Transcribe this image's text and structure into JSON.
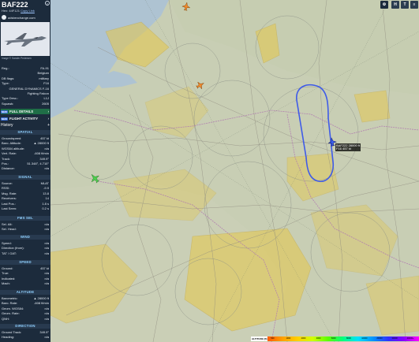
{
  "aircraft": {
    "callsign": "BAF222",
    "hex_label": "Hex:",
    "hex": "44F121",
    "copy_link": "Copy Link",
    "source": "adsbexchange.com",
    "photo_credit": "Image © Sander Pedersen"
  },
  "details": [
    {
      "k": "Reg.:",
      "v": "FA-91"
    },
    {
      "k": "",
      "v": "Belgium"
    },
    {
      "k": "DB flags:",
      "v": "military"
    },
    {
      "k": "Type:",
      "v": "F16"
    },
    {
      "k": "",
      "v": "GENERAL DYNAMICS F-16"
    },
    {
      "k": "",
      "v": "Fighting Falcon"
    },
    {
      "k": "Type Desc.:",
      "v": "L1J"
    },
    {
      "k": "Squawk:",
      "v": "2605"
    }
  ],
  "buttons": {
    "full_details": "FULL DETAILS",
    "flight_activity": "FLIGHT ACTIVITY",
    "new_tag": "NEW",
    "history": "History",
    "history_plus": "+"
  },
  "sections": {
    "spatial": "SPATIAL",
    "signal": "SIGNAL",
    "fms_sel": "FMS SEL",
    "wind": "WIND",
    "speed": "SPEED",
    "altitude": "ALTITUDE",
    "direction": "DIRECTION"
  },
  "spatial": [
    {
      "k": "Groundspeed:",
      "v": "457 kt"
    },
    {
      "k": "Baro. Altitude:",
      "v": "▲ 28000 ft"
    },
    {
      "k": "WGS84 altitude:",
      "v": "n/a"
    },
    {
      "k": "Vert. Rate:",
      "v": "-608 ft/min"
    },
    {
      "k": "Track:",
      "v": "349.9°"
    },
    {
      "k": "Pos.:",
      "v": "51.348°, 4.710°"
    },
    {
      "k": "Distance:",
      "v": "n/a"
    }
  ],
  "signal": [
    {
      "k": "Source:",
      "v": "MLAT"
    },
    {
      "k": "RSSI:",
      "v": "-9.9"
    },
    {
      "k": "Msg. Rate:",
      "v": "13.8"
    },
    {
      "k": "Receivers:",
      "v": "14"
    },
    {
      "k": "Last Pos.:",
      "v": "1.8 s"
    },
    {
      "k": "Last Seen:",
      "v": "0.2 s"
    }
  ],
  "fms": [
    {
      "k": "Sel. Alt:",
      "v": "n/a"
    },
    {
      "k": "Sel. Head:",
      "v": "n/a"
    }
  ],
  "wind": [
    {
      "k": "Speed:",
      "v": "n/a"
    },
    {
      "k": "Direction (from):",
      "v": "n/a"
    },
    {
      "k": "TAT / OAT:",
      "v": "n/a"
    }
  ],
  "speed": [
    {
      "k": "Ground:",
      "v": "457 kt"
    },
    {
      "k": "True:",
      "v": "n/a"
    },
    {
      "k": "Indicated:",
      "v": "n/a"
    },
    {
      "k": "Mach:",
      "v": "n/a"
    }
  ],
  "altitude": [
    {
      "k": "Barometric:",
      "v": "▲ 28000 ft"
    },
    {
      "k": "Baro. Rate:",
      "v": "-608 ft/min"
    },
    {
      "k": "Geom. WGS84:",
      "v": "n/a"
    },
    {
      "k": "Geom. Rate:",
      "v": "n/a"
    },
    {
      "k": "QNH:",
      "v": "n/a"
    }
  ],
  "direction": [
    {
      "k": "Ground Track:",
      "v": "349.9°"
    },
    {
      "k": "Heading:",
      "v": "n/a"
    }
  ],
  "map": {
    "controls": [
      "H",
      "T",
      "≡"
    ],
    "aircraft_label_line1": "BAF222 28000 ft",
    "aircraft_label_line2": "F16 457 kt",
    "legend_unit": "ALTITUDE (ft)",
    "legend_ticks": [
      "500",
      "1000",
      "2000",
      "4000",
      "6000",
      "8000",
      "10000",
      "20000",
      "30000",
      "40000+"
    ]
  },
  "colors": {
    "sidebar_bg": "#1c2b3c",
    "section_text": "#8fd0ff",
    "track": "#3f5be8",
    "airspace_yellow": "#e6c84a",
    "water": "#aec3d2"
  }
}
